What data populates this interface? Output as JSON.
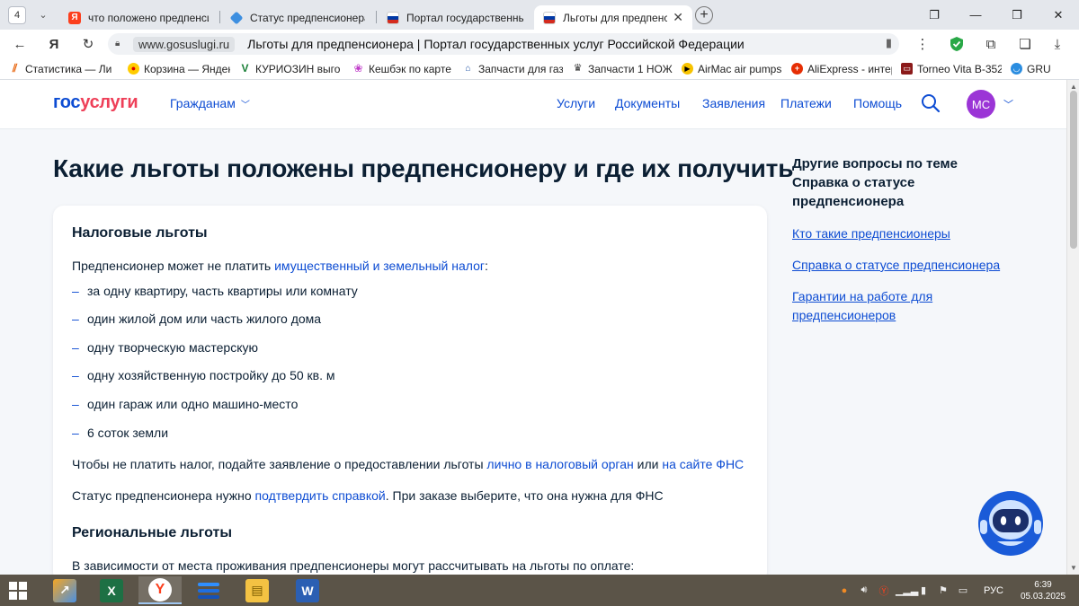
{
  "browser": {
    "tab_count": "4",
    "tabs": [
      {
        "title": "что положено предпенсионеру"
      },
      {
        "title": "Статус предпенсионера"
      },
      {
        "title": "Портал государственных услуг"
      },
      {
        "title": "Льготы для предпенсионера"
      }
    ],
    "address": {
      "domain": "www.gosuslugi.ru",
      "page_title": "Льготы для предпенсионера | Портал государственных услуг Российской Федерации"
    },
    "bookmarks": [
      {
        "label": "Статистика — Ли"
      },
      {
        "label": "Корзина — Яндек"
      },
      {
        "label": "КУРИОЗИН выго"
      },
      {
        "label": "Кешбэк по карте"
      },
      {
        "label": "Запчасти для газ"
      },
      {
        "label": "Запчасти 1 НОЖ,"
      },
      {
        "label": "AirMac air pumps"
      },
      {
        "label": "AliExpress - интер"
      },
      {
        "label": "Torneo Vita B-352"
      },
      {
        "label": "GRU"
      }
    ]
  },
  "site": {
    "logo_part1": "гос",
    "logo_part2": "услуги",
    "audience": "Гражданам",
    "nav": [
      "Услуги",
      "Документы",
      "Заявления",
      "Платежи",
      "Помощь"
    ],
    "avatar_initials": "МС"
  },
  "article": {
    "title": "Какие льготы положены предпенсионеру и где их получить",
    "tax": {
      "heading": "Налоговые льготы",
      "intro_before": "Предпенсионер может не платить ",
      "intro_link": "имущественный и земельный налог",
      "intro_after": ":",
      "items": [
        "за одну квартиру, часть квартиры или комнату",
        "один жилой дом или часть жилого дома",
        "одну творческую мастерскую",
        "одну хозяйственную постройку до 50 кв. м",
        "один гараж или одно машино-место",
        "6 соток земли"
      ],
      "apply_before": "Чтобы не платить налог, подайте заявление о предоставлении льготы ",
      "apply_link1": "лично в налоговый орган",
      "apply_mid": " или ",
      "apply_link2": "на сайте ФНС",
      "status_before": "Статус предпенсионера нужно ",
      "status_link": "подтвердить справкой",
      "status_after": ". При заказе выберите, что она нужна для ФНС"
    },
    "regional": {
      "heading": "Региональные льготы",
      "intro": "В зависимости от места проживания предпенсионеры могут рассчитывать на льготы по оплате:"
    }
  },
  "related": {
    "heading": "Другие вопросы по теме Справка о статусе предпенсионера",
    "links": [
      "Кто такие предпенсионеры",
      "Справка о статусе предпенсионера",
      "Гарантии на работе для предпенсионеров"
    ]
  },
  "taskbar": {
    "language": "РУС",
    "time": "6:39",
    "date": "05.03.2025"
  },
  "colors": {
    "brand_blue": "#0d4cd3",
    "brand_red": "#ee3f58",
    "avatar": "#9b35d6",
    "page_bg": "#f5f7fa",
    "text": "#0b1f33"
  }
}
